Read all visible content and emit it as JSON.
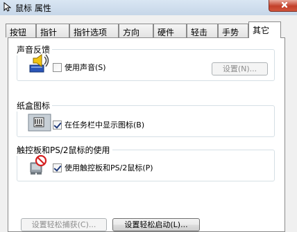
{
  "window": {
    "title": "鼠标 属性"
  },
  "tabs": [
    {
      "label": "按钮"
    },
    {
      "label": "指针"
    },
    {
      "label": "指针选项"
    },
    {
      "label": "方向"
    },
    {
      "label": "硬件"
    },
    {
      "label": "轻击"
    },
    {
      "label": "手势"
    },
    {
      "label": "其它"
    }
  ],
  "active_tab_index": 7,
  "sound_group": {
    "title": "声音反馈",
    "checkbox_label": "使用声音(S)",
    "checked": false,
    "settings_button": "设置(N)..."
  },
  "tray_group": {
    "title": "纸盒图标",
    "checkbox_label": "在任务栏中显示图标(B)",
    "checked": true
  },
  "touchpad_group": {
    "title": "触控板和PS/2鼠标的使用",
    "checkbox_label": "使用触控板和PS/2鼠标(P)",
    "checked": true
  },
  "bottom_buttons": {
    "easy_capture": "设置轻松捕获(C)...",
    "easy_launch": "设置轻松启动(L)..."
  }
}
